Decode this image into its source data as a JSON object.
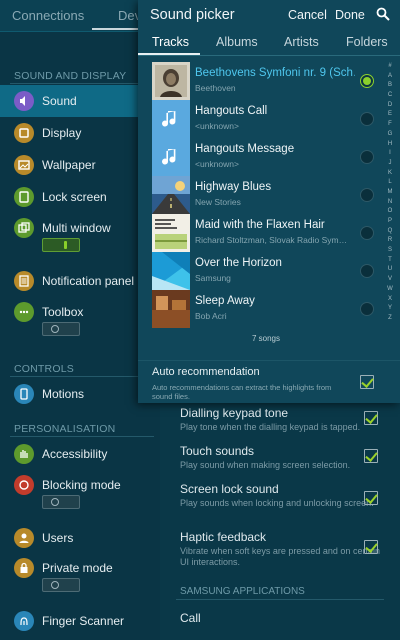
{
  "top_tabs": {
    "connections": "Connections",
    "device": "Dev"
  },
  "settings_menu": {
    "sections": {
      "sound_display": "SOUND AND DISPLAY",
      "controls": "CONTROLS",
      "personalisation": "PERSONALISATION"
    },
    "items": [
      {
        "label": "Sound",
        "icon": "speaker-icon",
        "color": "#7b5cc7",
        "selected": true
      },
      {
        "label": "Display",
        "icon": "display-icon",
        "color": "#b88a2a"
      },
      {
        "label": "Wallpaper",
        "icon": "wallpaper-icon",
        "color": "#b88a2a"
      },
      {
        "label": "Lock screen",
        "icon": "lock-screen-icon",
        "color": "#5d9a2d"
      },
      {
        "label": "Multi window",
        "icon": "multi-window-icon",
        "color": "#5d9a2d",
        "toggle": "on"
      },
      {
        "label": "Notification panel",
        "icon": "notification-panel-icon",
        "color": "#b88a2a"
      },
      {
        "label": "Toolbox",
        "icon": "toolbox-icon",
        "color": "#5d9a2d",
        "toggle": "off"
      },
      {
        "label": "Motions",
        "icon": "motions-icon",
        "color": "#2a86b8"
      },
      {
        "label": "Accessibility",
        "icon": "accessibility-icon",
        "color": "#5d9a2d"
      },
      {
        "label": "Blocking mode",
        "icon": "blocking-mode-icon",
        "color": "#c23c2c",
        "toggle": "off"
      },
      {
        "label": "Users",
        "icon": "users-icon",
        "color": "#b88a2a"
      },
      {
        "label": "Private mode",
        "icon": "private-mode-icon",
        "color": "#b88a2a",
        "toggle": "off"
      },
      {
        "label": "Finger Scanner",
        "icon": "finger-scanner-icon",
        "color": "#2a86b8"
      }
    ]
  },
  "sound_settings": [
    {
      "title": "Dialling keypad tone",
      "desc": "Play tone when the dialling keypad is tapped."
    },
    {
      "title": "Touch sounds",
      "desc": "Play sound when making screen selection."
    },
    {
      "title": "Screen lock sound",
      "desc": "Play sounds when locking and unlocking screen."
    },
    {
      "title": "Haptic feedback",
      "desc": "Vibrate when soft keys are pressed and on certain UI interactions."
    }
  ],
  "samsung_apps": {
    "header": "SAMSUNG APPLICATIONS",
    "call": "Call"
  },
  "picker": {
    "title": "Sound picker",
    "cancel": "Cancel",
    "done": "Done",
    "search_icon": "search-icon",
    "tabs": [
      "Tracks",
      "Albums",
      "Artists",
      "Folders"
    ],
    "active_tab": "Tracks",
    "tracks": [
      {
        "title": "Beethovens Symfoni nr. 9 (Sch…",
        "artist": "Beethoven",
        "art": "portrait",
        "selected": true
      },
      {
        "title": "Hangouts Call",
        "artist": "<unknown>",
        "art": "note"
      },
      {
        "title": "Hangouts Message",
        "artist": "<unknown>",
        "art": "note"
      },
      {
        "title": "Highway Blues",
        "artist": "New Stories",
        "art": "highway"
      },
      {
        "title": "Maid with the Flaxen Hair",
        "artist": "Richard Stoltzman, Slovak Radio Sym…",
        "art": "document"
      },
      {
        "title": "Over the Horizon",
        "artist": "Samsung",
        "art": "horizon"
      },
      {
        "title": "Sleep Away",
        "artist": "Bob Acri",
        "art": "sleep"
      }
    ],
    "song_count": "7 songs",
    "alphabet": [
      "#",
      "A",
      "B",
      "C",
      "D",
      "E",
      "F",
      "G",
      "H",
      "I",
      "J",
      "K",
      "L",
      "M",
      "N",
      "O",
      "P",
      "Q",
      "R",
      "S",
      "T",
      "U",
      "V",
      "W",
      "X",
      "Y",
      "Z"
    ],
    "auto_recommendation": {
      "title": "Auto recommendation",
      "desc": "Auto recommendations can extract the highlights from sound files."
    }
  },
  "colors": {
    "accent": "#4fc7ee",
    "check": "#8bd12c",
    "selected_bg": "#0f6a86"
  }
}
